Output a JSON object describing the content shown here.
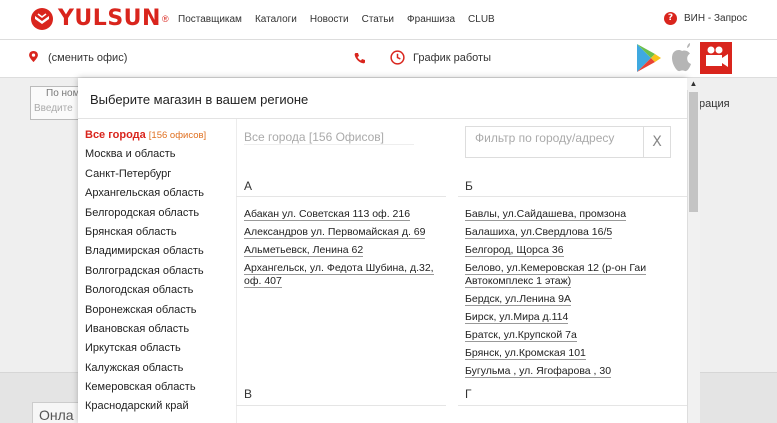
{
  "brand": {
    "name": "YULSUN",
    "reg": "®",
    "accent": "#d9251d"
  },
  "nav": [
    "Поставщикам",
    "Каталоги",
    "Новости",
    "Статьи",
    "Франшиза",
    "CLUB"
  ],
  "vin": {
    "icon": "question-icon",
    "glyph": "?",
    "label": "ВИН - Запрос"
  },
  "office": {
    "label": "(сменить офис)"
  },
  "schedule": {
    "label": "График работы"
  },
  "background": {
    "search_tab": "По ном",
    "search_input": "Введите",
    "right_text": "рация",
    "bottom_text": "Онла"
  },
  "modal": {
    "title": "Выберите магазин в вашем регионе",
    "all_cities_active": "Все города",
    "all_cities_count": "[156 офисов]",
    "all_cities_heading": "Все города [156 Офисов]",
    "filter_placeholder": "Фильтр по городу/адресу",
    "filter_clear": "X",
    "regions": [
      "Москва и область",
      "Санкт-Петербург",
      "Архангельская область",
      "Белгородская область",
      "Брянская область",
      "Владимирская область",
      "Волгоградская область",
      "Вологодская область",
      "Воронежская область",
      "Ивановская область",
      "Иркутская область",
      "Калужская область",
      "Кемеровская область",
      "Краснодарский край"
    ],
    "groups": {
      "a": {
        "letter": "А",
        "stores": [
          "Абакан ул. Советская 113 оф. 216",
          "Александров ул. Первомайская д. 69",
          "Альметьевск, Ленина 62",
          "Архангельск, ул. Федота Шубина, д.32, оф. 407"
        ]
      },
      "b": {
        "letter": "Б",
        "stores": [
          "Бавлы, ул.Сайдашева, промзона",
          "Балашиха, ул.Свердлова 16/5",
          "Белгород, Щорса 36",
          "Белово, ул.Кемеровская 12 (р-он Гаи Автокомплекс 1 этаж)",
          "Бердск, ул.Ленина 9А",
          "Бирск, ул.Мира д.114",
          "Братск, ул.Крупской 7а",
          "Брянск, ул.Кромская 101",
          "Бугульма , ул. Ягофарова , 30"
        ]
      },
      "v": {
        "letter": "В"
      },
      "g": {
        "letter": "Г"
      }
    }
  }
}
